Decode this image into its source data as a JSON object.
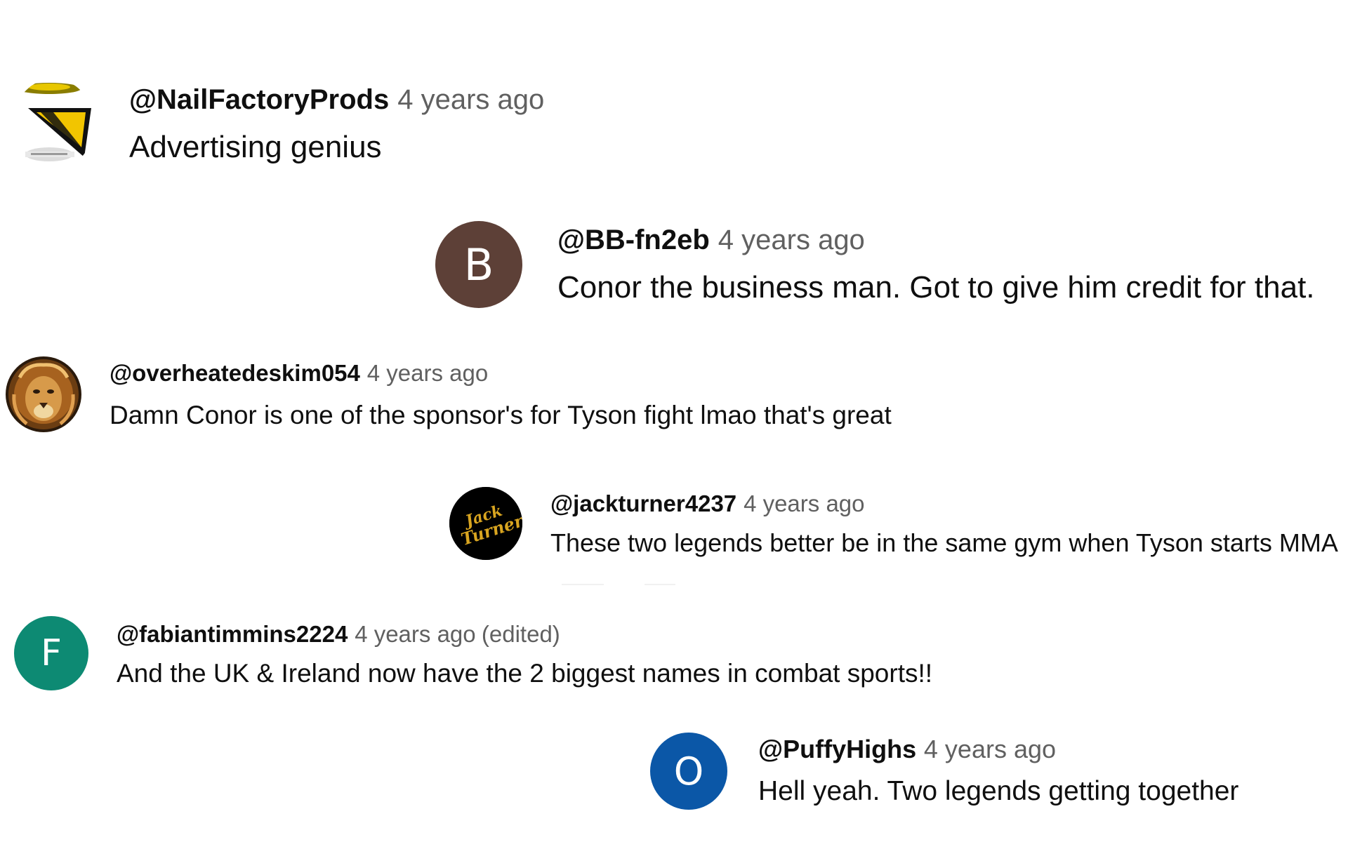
{
  "comments": [
    {
      "handle": "@NailFactoryProds",
      "time": "4 years ago",
      "text": "Advertising genius",
      "avatar": {
        "type": "logo",
        "icon": "nail-factory-logo-icon",
        "colors": [
          "#f2c500",
          "#111111",
          "#ffffff"
        ]
      }
    },
    {
      "handle": "@BB-fn2eb",
      "time": "4 years ago",
      "text": "Conor the business man. Got to give him credit for that.",
      "avatar": {
        "type": "letter",
        "letter": "B",
        "color": "#5d4037"
      }
    },
    {
      "handle": "@overheatedeskim054",
      "time": "4 years ago",
      "text": "Damn Conor is one of the sponsor's for Tyson fight lmao that's great",
      "avatar": {
        "type": "image",
        "icon": "lion-icon",
        "colors": [
          "#2a1a0c",
          "#c48a3a",
          "#f0d7a0"
        ]
      }
    },
    {
      "handle": "@jackturner4237",
      "time": "4 years ago",
      "text": "These two legends better be in the same gym when Tyson starts MMA",
      "avatar": {
        "type": "logo",
        "icon": "jack-turner-logo-icon",
        "colors": [
          "#000000",
          "#d9a520"
        ]
      }
    },
    {
      "handle": "@fabiantimmins2224",
      "time": "4 years ago",
      "edited": "(edited)",
      "text": "And the UK & Ireland now have the 2 biggest names in combat sports!!",
      "avatar": {
        "type": "letter",
        "letter": "F",
        "color": "#0d8a73"
      }
    },
    {
      "handle": "@PuffyHighs",
      "time": "4 years ago",
      "text": "Hell yeah. Two legends getting together",
      "avatar": {
        "type": "letter",
        "letter": "O",
        "color": "#0b57a7"
      }
    }
  ]
}
